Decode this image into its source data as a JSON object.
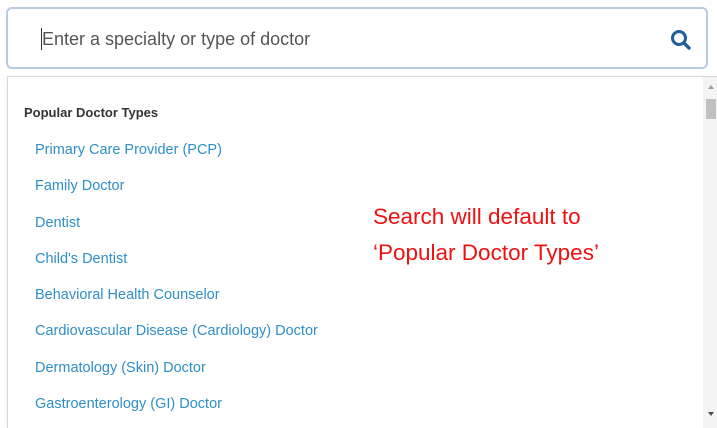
{
  "search": {
    "placeholder": "Enter a specialty or type of doctor",
    "value": "",
    "icon": "search-icon"
  },
  "dropdown": {
    "section_header": "Popular Doctor Types",
    "items": [
      {
        "label": "Primary Care Provider (PCP)"
      },
      {
        "label": "Family Doctor"
      },
      {
        "label": "Dentist"
      },
      {
        "label": "Child's Dentist"
      },
      {
        "label": "Behavioral Health Counselor"
      },
      {
        "label": "Cardiovascular Disease (Cardiology) Doctor"
      },
      {
        "label": "Dermatology (Skin) Doctor"
      },
      {
        "label": "Gastroenterology (GI) Doctor"
      }
    ]
  },
  "annotation": {
    "line1": "Search will default to",
    "line2": "‘Popular Doctor Types’"
  },
  "colors": {
    "link": "#2f8fc7",
    "annotation": "#ee1111",
    "search_border": "#b9cbe0",
    "search_icon": "#1f5d9e"
  }
}
